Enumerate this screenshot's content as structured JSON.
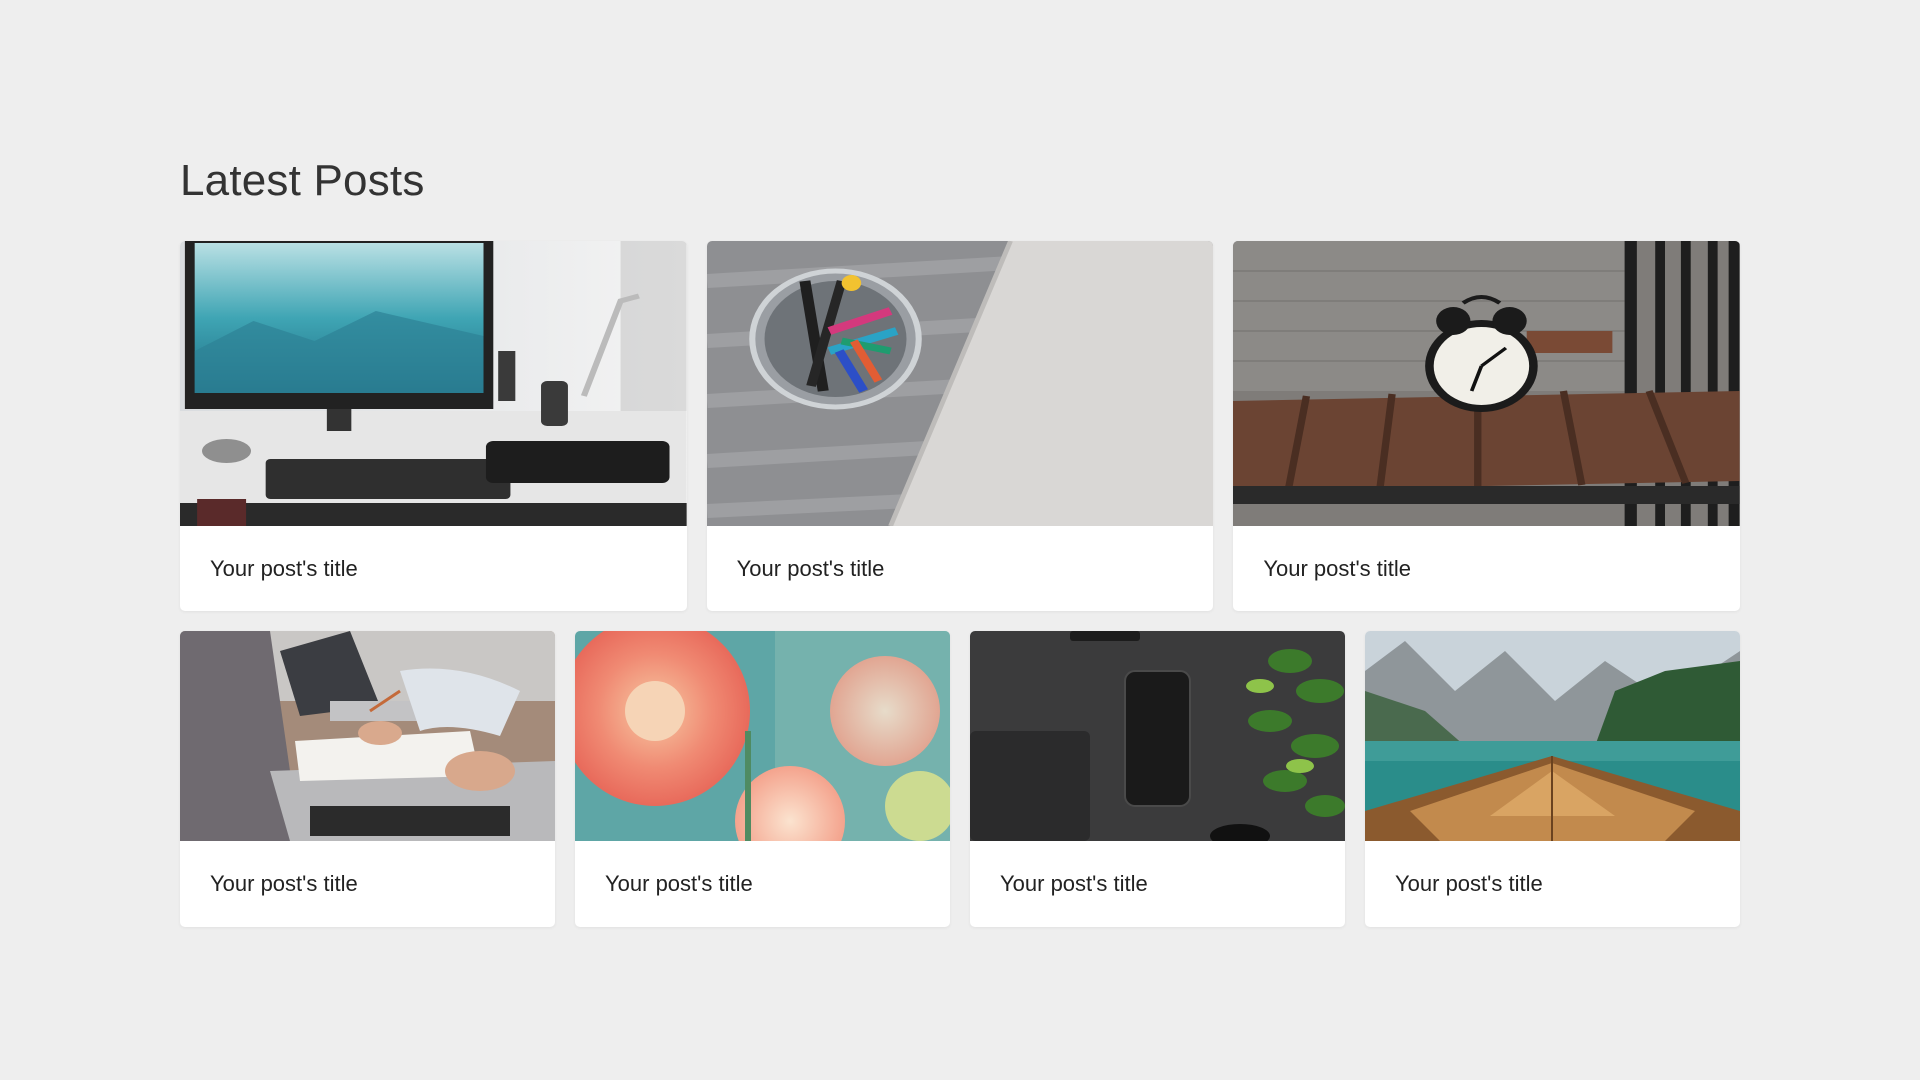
{
  "section": {
    "title": "Latest Posts"
  },
  "posts_top": [
    {
      "title": "Your post's title",
      "image": "desk-setup-photo"
    },
    {
      "title": "Your post's title",
      "image": "pen-jar-notebook-photo"
    },
    {
      "title": "Your post's title",
      "image": "alarm-clock-table-photo"
    }
  ],
  "posts_bottom": [
    {
      "title": "Your post's title",
      "image": "laptop-meeting-photo"
    },
    {
      "title": "Your post's title",
      "image": "dahlia-flowers-photo"
    },
    {
      "title": "Your post's title",
      "image": "phone-on-desk-photo"
    },
    {
      "title": "Your post's title",
      "image": "lake-boat-photo"
    }
  ],
  "colors": {
    "page_background": "#eeeeee",
    "card_background": "#ffffff",
    "heading_text": "#333333",
    "caption_text": "#222222"
  }
}
